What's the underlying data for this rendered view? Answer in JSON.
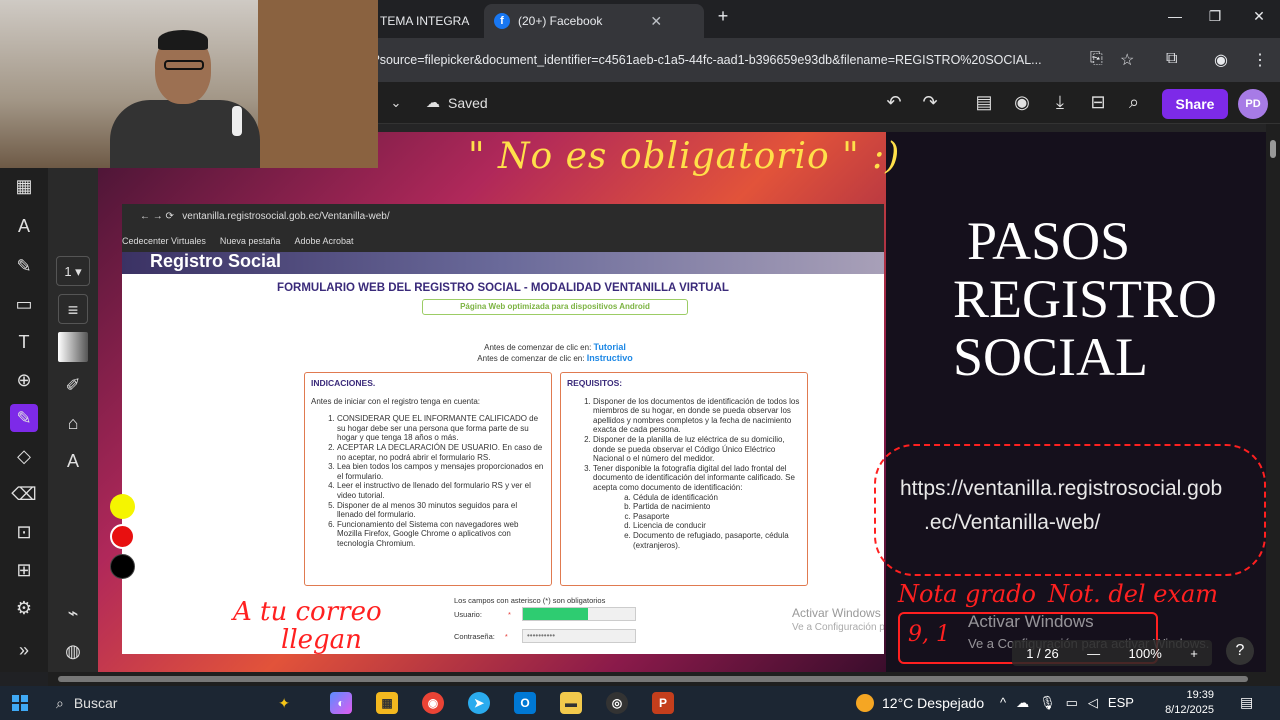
{
  "browser": {
    "tabs": [
      {
        "label": "TEMA INTEGRA"
      },
      {
        "label": "(20+) Facebook"
      }
    ],
    "url": "l?source=filepicker&document_identifier=c4561aeb-c1a5-44fc-aad1-b396659e93db&filename=REGISTRO%20SOCIAL..."
  },
  "toolbar": {
    "saved_label": "Saved",
    "share_label": "Share",
    "avatar_initials": "PD",
    "page_select": "1"
  },
  "slide": {
    "note_title": "\" No es obligatorio \" :)",
    "steps_title_lines": [
      "PASOS",
      "REGISTRO",
      "SOCIAL"
    ],
    "url_line1": "https://ventanilla.registrosocial.gob",
    "url_line2": ".ec/Ventanilla-web/",
    "nota_grado": "Nota grado",
    "nota_grado_value": "9, 1",
    "nota_examen": "Not. del exam",
    "correo_line1": "A tu correo",
    "correo_line2": "llegan"
  },
  "embed": {
    "address": "ventanilla.registrosocial.gob.ec/Ventanilla-web/",
    "bookmarks": [
      "Cedecenter Virtuales",
      "Nueva pestaña",
      "Adobe Acrobat"
    ],
    "banner": "Registro Social",
    "form_title": "FORMULARIO WEB DEL REGISTRO SOCIAL - MODALIDAD VENTANILLA VIRTUAL",
    "android_note": "Página Web optimizada para dispositivos Android",
    "tutorial_prefix": "Antes de comenzar de clic en:",
    "tutorial_link": "Tutorial",
    "instructivo_prefix": "Antes de comenzar de clic en:",
    "instructivo_link": "Instructivo",
    "indicaciones_title": "INDICACIONES.",
    "indicaciones_intro": "Antes de iniciar con el registro tenga en cuenta:",
    "indicaciones": [
      "CONSIDERAR QUE EL INFORMANTE CALIFICADO de su hogar debe ser una persona que forma parte de su hogar y que tenga 18 años o más.",
      "ACEPTAR LA DECLARACIÓN DE USUARIO. En caso de no aceptar, no podrá abrir el formulario RS.",
      "Lea bien todos los campos y mensajes proporcionados en el formulario.",
      "Leer el instructivo de llenado del formulario RS y ver el video tutorial.",
      "Disponer de al menos 30 minutos seguidos para el llenado del formulario.",
      "Funcionamiento del Sistema con navegadores web Mozilla Firefox, Google Chrome o aplicativos con tecnología Chromium."
    ],
    "requisitos_title": "REQUISITOS:",
    "requisitos": [
      "Disponer de los documentos de identificación de todos los miembros de su hogar, en donde se pueda observar los apellidos y nombres completos y la fecha de nacimiento exacta de cada persona.",
      "Disponer de la planilla de luz eléctrica de su domicilio, donde se pueda observar el Código Único Eléctrico Nacional o el número del medidor.",
      "Tener disponible la fotografía digital del lado frontal del documento de identificación del informante calificado. Se acepta como documento de identificación:"
    ],
    "documentos": [
      "Cédula de identificación",
      "Partida de nacimiento",
      "Pasaporte",
      "Licencia de conducir",
      "Documento de refugiado, pasaporte, cédula (extranjeros)."
    ],
    "login_note": "Los campos con asterisco (*) son obligatorios",
    "usuario_label": "Usuario:",
    "contrasena_label": "Contraseña:",
    "contrasena_value": "••••••••••",
    "usuario_fill": 0.58,
    "activar_small": "Activar Windows",
    "activar_small_sub": "Ve a Configuración p"
  },
  "viewer": {
    "page_indicator": "1 / 26",
    "zoom": "100%",
    "help": "?"
  },
  "windows_activation": {
    "title": "Activar Windows",
    "subtitle": "Ve a Configuración para activar Windows."
  },
  "taskbar": {
    "search_label": "Buscar",
    "weather": "12°C  Despejado",
    "language": "ESP",
    "time": "19:39",
    "date": "8/12/2025"
  },
  "colors": {
    "share_purple": "#7d2ae8",
    "annotation_red": "#ff2020",
    "note_yellow": "#ffe04a",
    "swatches": [
      "#f5f500",
      "#e81010",
      "#000000"
    ]
  }
}
